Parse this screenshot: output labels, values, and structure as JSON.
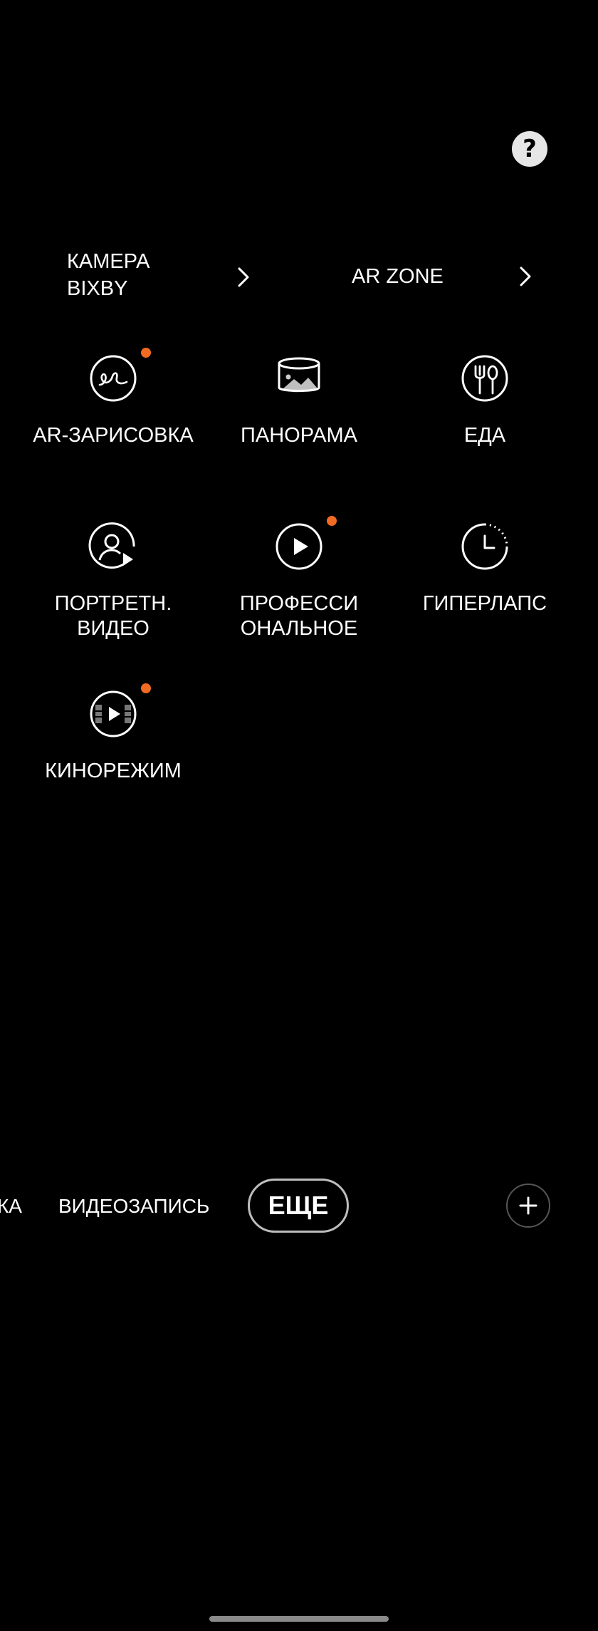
{
  "help": {
    "glyph": "?",
    "icon": "question-icon"
  },
  "links": [
    {
      "label": "КАМЕРА\nBIXBY",
      "icon": "chevron-right-icon"
    },
    {
      "label": "AR ZONE",
      "icon": "chevron-right-icon"
    }
  ],
  "modes": [
    {
      "label": "AR-ЗАРИСОВКА",
      "icon": "ar-doodle-icon",
      "new_badge": true
    },
    {
      "label": "ПАНОРАМА",
      "icon": "panorama-icon",
      "new_badge": false
    },
    {
      "label": "ЕДА",
      "icon": "food-icon",
      "new_badge": false
    },
    {
      "label": "ПОРТРЕТН.\nВИДЕО",
      "icon": "portrait-video-icon",
      "new_badge": false
    },
    {
      "label": "ПРОФЕССИ\nОНАЛЬНОЕ",
      "icon": "pro-video-icon",
      "new_badge": true
    },
    {
      "label": "ГИПЕРЛАПС",
      "icon": "hyperlapse-icon",
      "new_badge": false
    },
    {
      "label": "КИНОРЕЖИМ",
      "icon": "director-view-icon",
      "new_badge": true
    }
  ],
  "bottom_bar": {
    "partial_tab": "КА",
    "video_tab": "ВИДЕОЗАПИСЬ",
    "more_tab": "ЕЩЕ",
    "add_icon": "plus-icon"
  },
  "colors": {
    "background": "#000000",
    "badge": "#f26b22",
    "text": "#ffffff"
  }
}
